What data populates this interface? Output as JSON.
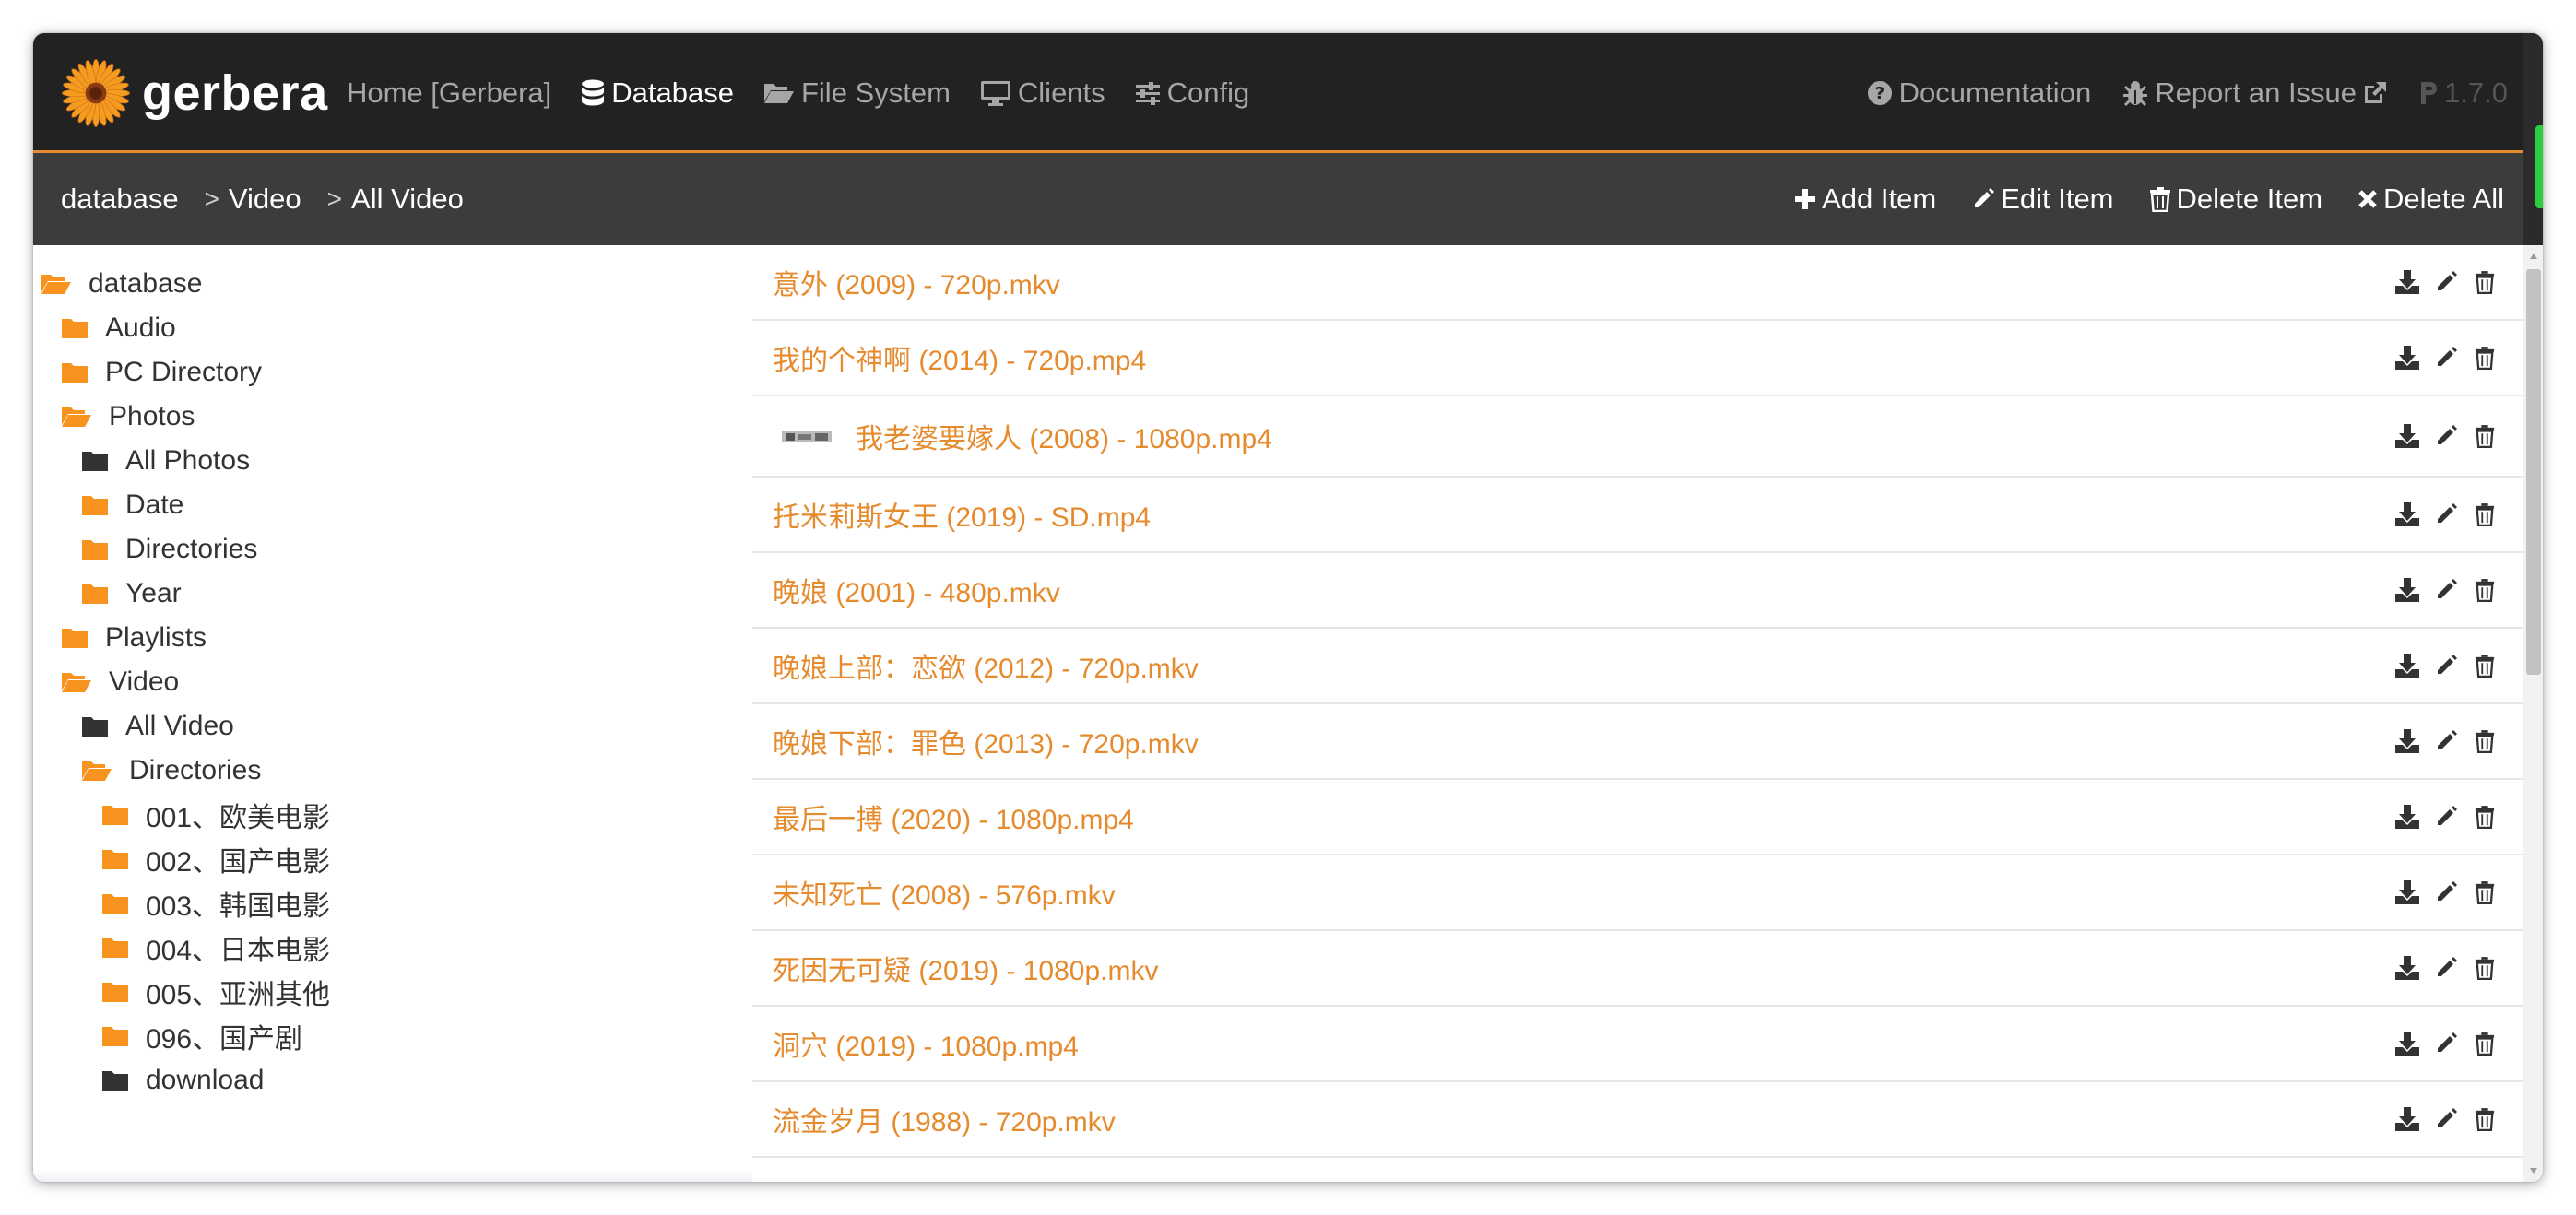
{
  "brand": {
    "name": "gerbera"
  },
  "nav": {
    "home": "Home [Gerbera]",
    "database": "Database",
    "filesystem": "File System",
    "clients": "Clients",
    "config": "Config",
    "documentation": "Documentation",
    "report": "Report an Issue",
    "version": "1.7.0"
  },
  "breadcrumb": [
    "database",
    "Video",
    "All Video"
  ],
  "actions": {
    "add": "Add Item",
    "edit": "Edit Item",
    "delete": "Delete Item",
    "delete_all": "Delete All"
  },
  "tree": [
    {
      "label": "database",
      "state": "open",
      "color": "orange"
    },
    {
      "label": "Audio",
      "state": "closed",
      "color": "orange"
    },
    {
      "label": "PC Directory",
      "state": "closed",
      "color": "orange"
    },
    {
      "label": "Photos",
      "state": "open",
      "color": "orange"
    },
    {
      "label": "All Photos",
      "state": "closed",
      "color": "dark"
    },
    {
      "label": "Date",
      "state": "closed",
      "color": "orange"
    },
    {
      "label": "Directories",
      "state": "closed",
      "color": "orange"
    },
    {
      "label": "Year",
      "state": "closed",
      "color": "orange"
    },
    {
      "label": "Playlists",
      "state": "closed",
      "color": "orange"
    },
    {
      "label": "Video",
      "state": "open",
      "color": "orange"
    },
    {
      "label": "All Video",
      "state": "closed",
      "color": "dark"
    },
    {
      "label": "Directories",
      "state": "open",
      "color": "orange"
    },
    {
      "label": "001、欧美电影",
      "state": "closed",
      "color": "orange"
    },
    {
      "label": "002、国产电影",
      "state": "closed",
      "color": "orange"
    },
    {
      "label": "003、韩国电影",
      "state": "closed",
      "color": "orange"
    },
    {
      "label": "004、日本电影",
      "state": "closed",
      "color": "orange"
    },
    {
      "label": "005、亚洲其他",
      "state": "closed",
      "color": "orange"
    },
    {
      "label": "096、国产剧",
      "state": "closed",
      "color": "orange"
    },
    {
      "label": "download",
      "state": "closed",
      "color": "dark"
    }
  ],
  "items": [
    {
      "title": "意外 (2009) - 720p.mkv",
      "thumb": false
    },
    {
      "title": "我的个神啊 (2014) - 720p.mp4",
      "thumb": false
    },
    {
      "title": "我老婆要嫁人 (2008) - 1080p.mp4",
      "thumb": true
    },
    {
      "title": "托米莉斯女王 (2019) - SD.mp4",
      "thumb": false
    },
    {
      "title": "晚娘 (2001) - 480p.mkv",
      "thumb": false
    },
    {
      "title": "晚娘上部：恋欲 (2012) - 720p.mkv",
      "thumb": false
    },
    {
      "title": "晚娘下部：罪色 (2013) - 720p.mkv",
      "thumb": false
    },
    {
      "title": "最后一搏 (2020) - 1080p.mp4",
      "thumb": false
    },
    {
      "title": "未知死亡 (2008) - 576p.mkv",
      "thumb": false
    },
    {
      "title": "死因无可疑 (2019) - 1080p.mkv",
      "thumb": false
    },
    {
      "title": "洞穴 (2019) - 1080p.mp4",
      "thumb": false
    },
    {
      "title": "流金岁月 (1988) - 720p.mkv",
      "thumb": false
    }
  ],
  "colors": {
    "accent": "#e68a2e",
    "navbar": "#222222",
    "toolbar": "#3c3c3c",
    "folder_orange": "#f7931e",
    "folder_dark": "#333333"
  },
  "icons": {
    "row": [
      "download-icon",
      "pencil-icon",
      "trash-icon"
    ],
    "nav": [
      "database-icon",
      "folder-open-icon",
      "desktop-icon",
      "sliders-icon",
      "question-circle-icon",
      "bug-icon",
      "external-link-icon",
      "product-hunt-icon"
    ],
    "actions": [
      "plus-icon",
      "pencil-icon",
      "trash-icon",
      "times-icon"
    ]
  }
}
